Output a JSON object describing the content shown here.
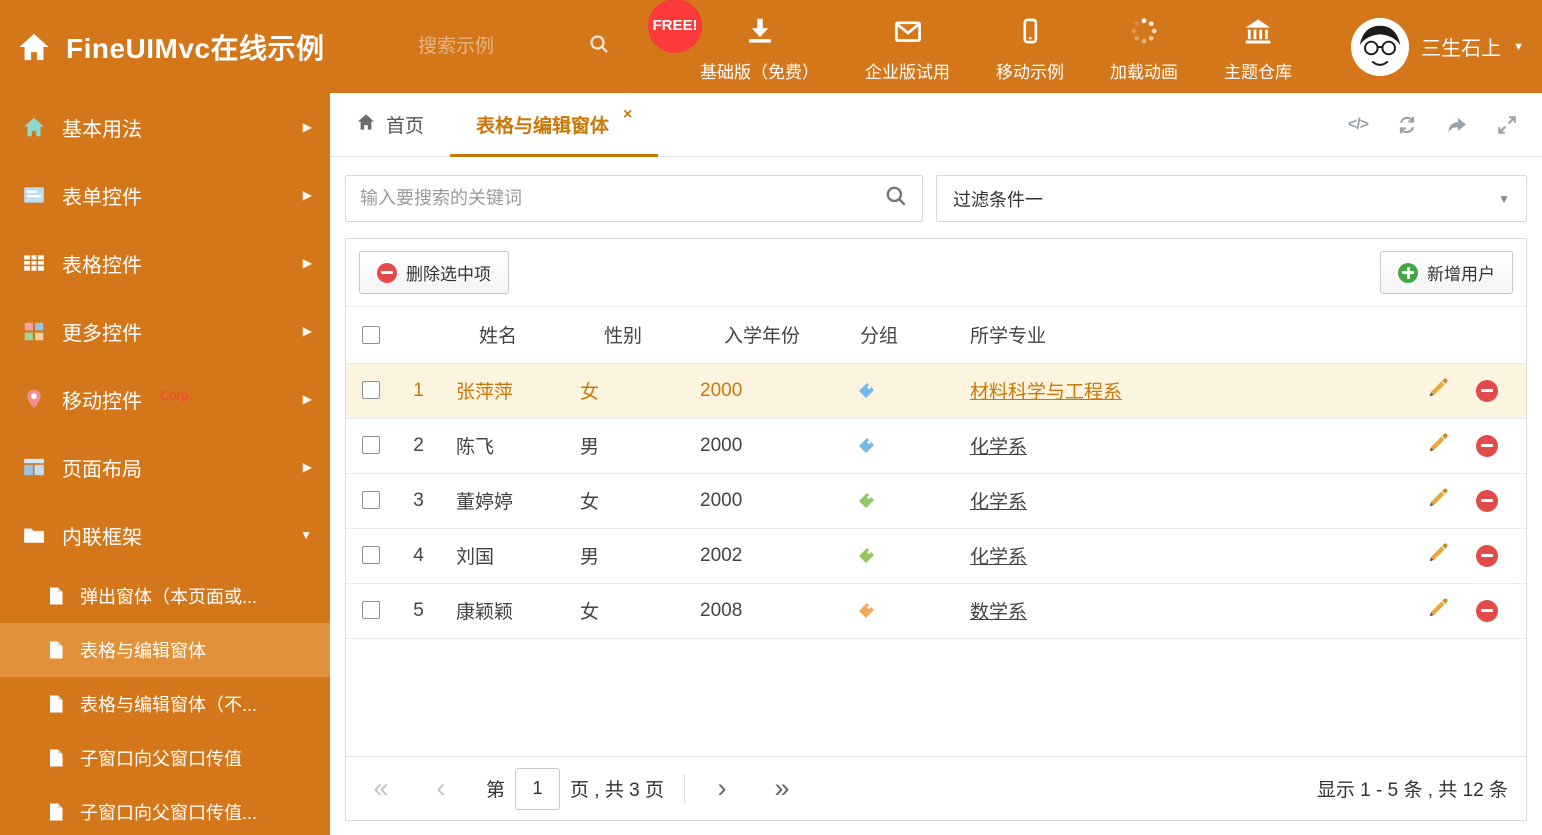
{
  "colors": {
    "accent": "#D4771B",
    "accent-light": "#E0913A",
    "active": "#C8790A",
    "free-red": "#FB3B3B",
    "danger": "#E14B4B",
    "success": "#46A546",
    "row-selected-bg": "#FDF4DF"
  },
  "header": {
    "title": "FineUIMvc在线示例",
    "search_placeholder": "搜索示例",
    "free_badge": "FREE!",
    "nav": [
      {
        "label": "基础版（免费）",
        "icon": "download-icon"
      },
      {
        "label": "企业版试用",
        "icon": "envelope-icon"
      },
      {
        "label": "移动示例",
        "icon": "mobile-icon"
      },
      {
        "label": "加载动画",
        "icon": "spinner-icon"
      },
      {
        "label": "主题仓库",
        "icon": "bank-icon"
      }
    ],
    "user_name": "三生石上"
  },
  "sidebar": {
    "items": [
      {
        "label": "基本用法",
        "icon": "home-icon"
      },
      {
        "label": "表单控件",
        "icon": "form-icon"
      },
      {
        "label": "表格控件",
        "icon": "table-icon"
      },
      {
        "label": "更多控件",
        "icon": "widgets-icon"
      },
      {
        "label": "移动控件",
        "badge": "Corp.",
        "icon": "pin-icon"
      },
      {
        "label": "页面布局",
        "icon": "layout-icon"
      },
      {
        "label": "内联框架",
        "icon": "folder-icon"
      }
    ],
    "subitems": [
      {
        "label": "弹出窗体（本页面或..."
      },
      {
        "label": "表格与编辑窗体"
      },
      {
        "label": "表格与编辑窗体（不..."
      },
      {
        "label": "子窗口向父窗口传值"
      },
      {
        "label": "子窗口向父窗口传值..."
      }
    ]
  },
  "tabs": {
    "home": "首页",
    "active": "表格与编辑窗体",
    "close": "×"
  },
  "filter": {
    "search_placeholder": "输入要搜索的关键词",
    "dropdown_value": "过滤条件一"
  },
  "toolbar": {
    "delete_label": "删除选中项",
    "add_label": "新增用户"
  },
  "table": {
    "headers": [
      "姓名",
      "性别",
      "入学年份",
      "分组",
      "所学专业"
    ],
    "rows": [
      {
        "num": "1",
        "name": "张萍萍",
        "gender": "女",
        "year": "2000",
        "tag_color": "#74B9E8",
        "major": "材料科学与工程系"
      },
      {
        "num": "2",
        "name": "陈飞",
        "gender": "男",
        "year": "2000",
        "tag_color": "#74B9E8",
        "major": "化学系"
      },
      {
        "num": "3",
        "name": "董婷婷",
        "gender": "女",
        "year": "2000",
        "tag_color": "#93C763",
        "major": "化学系"
      },
      {
        "num": "4",
        "name": "刘国",
        "gender": "男",
        "year": "2002",
        "tag_color": "#93C763",
        "major": "化学系"
      },
      {
        "num": "5",
        "name": "康颖颖",
        "gender": "女",
        "year": "2008",
        "tag_color": "#F3A95C",
        "major": "数学系"
      }
    ]
  },
  "pager": {
    "prefix": "第",
    "page": "1",
    "suffix": "页 , 共 3 页",
    "summary": "显示 1 - 5 条 , 共 12 条"
  }
}
